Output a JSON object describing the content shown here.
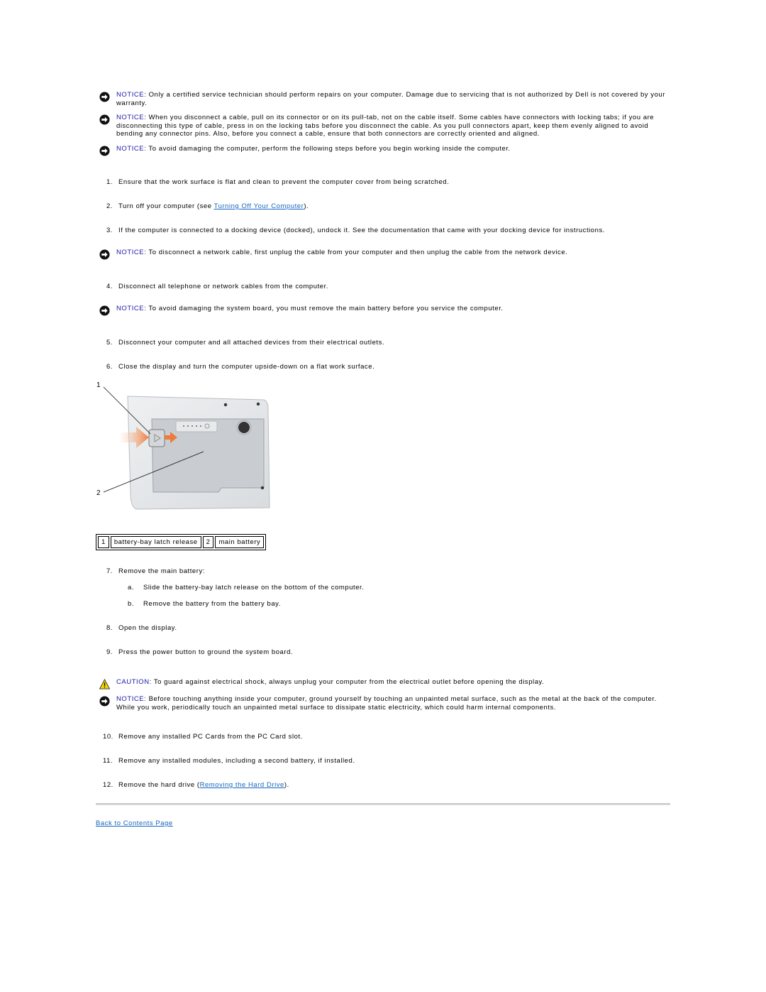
{
  "notices_top": [
    {
      "label": "NOTICE:",
      "text": " Only a certified service technician should perform repairs on your computer. Damage due to servicing that is not authorized by Dell is not covered by your warranty."
    },
    {
      "label": "NOTICE:",
      "text": " When you disconnect a cable, pull on its connector or on its pull-tab, not on the cable itself. Some cables have connectors with locking tabs; if you are disconnecting this type of cable, press in on the locking tabs before you disconnect the cable. As you pull connectors apart, keep them evenly aligned to avoid bending any connector pins. Also, before you connect a cable, ensure that both connectors are correctly oriented and aligned."
    },
    {
      "label": "NOTICE:",
      "text": " To avoid damaging the computer, perform the following steps before you begin working inside the computer."
    }
  ],
  "steps": {
    "s1": {
      "num": "1.",
      "text": "Ensure that the work surface is flat and clean to prevent the computer cover from being scratched."
    },
    "s2": {
      "num": "2.",
      "pre": "Turn off your computer (see ",
      "link": "Turning Off Your Computer",
      "post": ")."
    },
    "s3": {
      "num": "3.",
      "text": "If the computer is connected to a docking device (docked), undock it. See the documentation that came with your docking device for instructions."
    },
    "s4": {
      "num": "4.",
      "text": "Disconnect all telephone or network cables from the computer."
    },
    "s5": {
      "num": "5.",
      "text": "Disconnect your computer and all attached devices from their electrical outlets."
    },
    "s6": {
      "num": "6.",
      "text": "Close the display and turn the computer upside-down on a flat work surface."
    },
    "s7": {
      "num": "7.",
      "text": "Remove the main battery:"
    },
    "s7a": {
      "num": "a.",
      "text": "Slide the battery-bay latch release on the bottom of the computer."
    },
    "s7b": {
      "num": "b.",
      "text": "Remove the battery from the battery bay."
    },
    "s8": {
      "num": "8.",
      "text": "Open the display."
    },
    "s9": {
      "num": "9.",
      "text": "Press the power button to ground the system board."
    },
    "s10": {
      "num": "10.",
      "text": "Remove any installed PC Cards from the PC Card slot."
    },
    "s11": {
      "num": "11.",
      "text": "Remove any installed modules, including a second battery, if installed."
    },
    "s12": {
      "num": "12.",
      "pre": "Remove the hard drive (",
      "link": "Removing the Hard Drive",
      "post": ")."
    }
  },
  "notice_network": {
    "label": "NOTICE:",
    "text": " To disconnect a network cable, first unplug the cable from your computer and then unplug the cable from the network device."
  },
  "notice_board": {
    "label": "NOTICE:",
    "text": " To avoid damaging the system board, you must remove the main battery before you service the computer."
  },
  "caution": {
    "label": "CAUTION:",
    "text": " To guard against electrical shock, always unplug your computer from the electrical outlet before opening the display."
  },
  "notice_ground": {
    "label": "NOTICE:",
    "text": " Before touching anything inside your computer, ground yourself by touching an unpainted metal surface, such as the metal at the back of the computer. While you work, periodically touch an unpainted metal surface to dissipate static electricity, which could harm internal components."
  },
  "figure": {
    "callout_1": "1",
    "callout_2": "2",
    "description": "Bottom of laptop showing battery-bay latch release and main battery"
  },
  "legend": [
    {
      "num": "1",
      "label": "battery-bay latch release"
    },
    {
      "num": "2",
      "label": "main battery"
    }
  ],
  "footer": {
    "back_link": "Back to Contents Page"
  },
  "colors": {
    "notice_label": "#1a1aa6",
    "link": "#1565c0",
    "caution_yellow": "#f2d600"
  }
}
